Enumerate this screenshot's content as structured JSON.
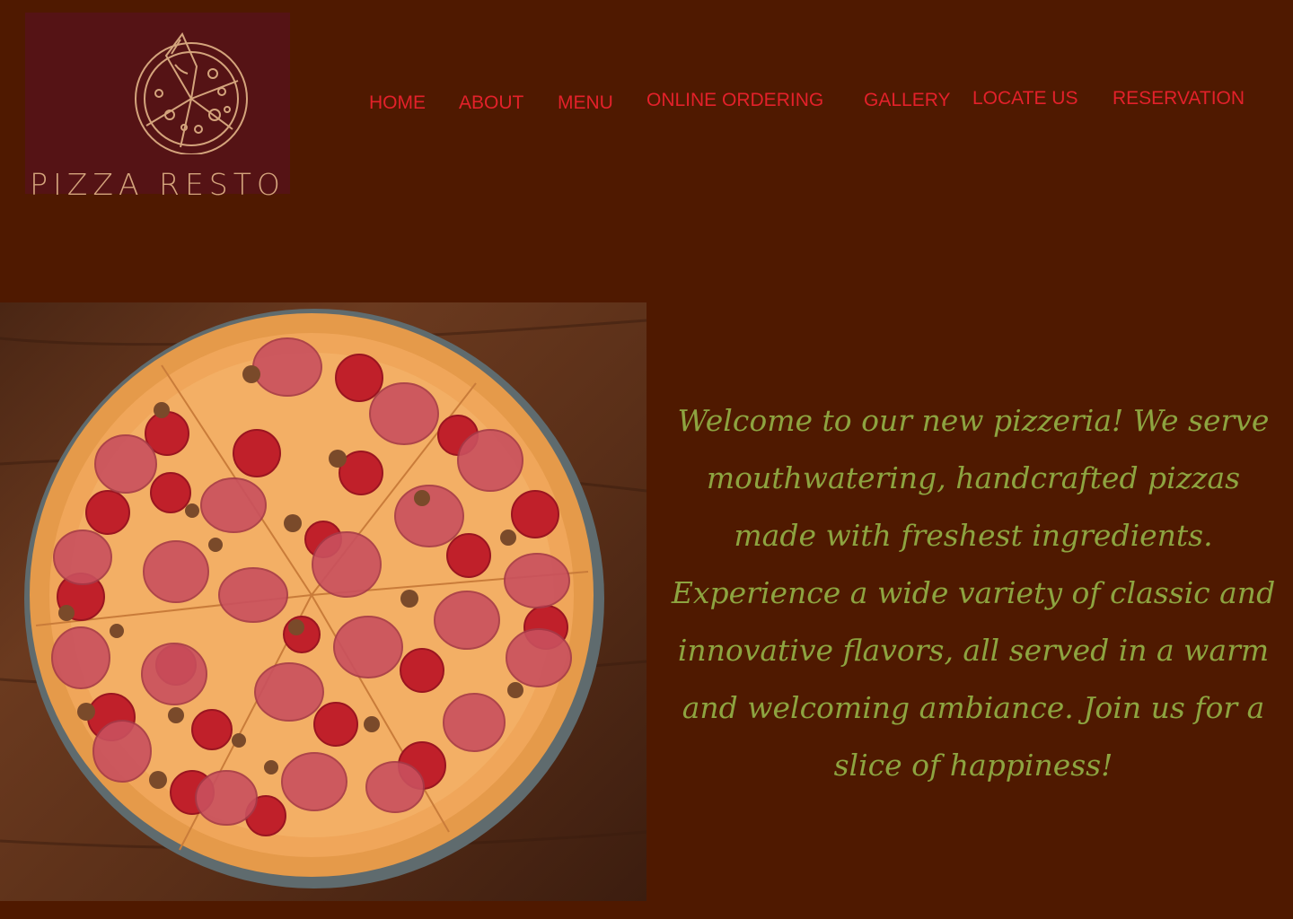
{
  "logo": {
    "brand_text": "PIZZA RESTO",
    "icon": "pizza-slice-icon"
  },
  "nav": {
    "items": [
      {
        "label": "HOME"
      },
      {
        "label": "ABOUT"
      },
      {
        "label": "MENU"
      },
      {
        "label": "ONLINE ORDERING"
      },
      {
        "label": "GALLERY"
      },
      {
        "label": "LOCATE US"
      },
      {
        "label": "RESERVATION"
      }
    ]
  },
  "hero": {
    "image_subject": "pepperoni-pizza-photo",
    "welcome_text": "Welcome to our new pizzeria! We serve mouthwatering, handcrafted pizzas made with freshest ingredients. Experience a wide variety of classic and innovative flavors, all served in a warm and welcoming ambiance. Join us for a slice of happiness!"
  },
  "colors": {
    "page_background": "#4f1900",
    "logo_background": "#551315",
    "logo_line": "#d4a47c",
    "nav_text": "#e3212a",
    "welcome_text": "#8da440"
  }
}
